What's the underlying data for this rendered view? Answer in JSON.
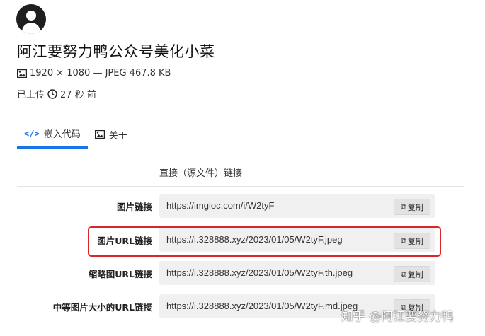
{
  "header": {
    "title": "阿江要努力鸭公众号美化小菜",
    "meta": "1920 × 1080 — JPEG 467.8 KB",
    "uploaded_prefix": "已上传",
    "uploaded_time": "27 秒 前"
  },
  "tabs": [
    {
      "label": "嵌入代码",
      "icon": "code-icon",
      "active": true
    },
    {
      "label": "关于",
      "icon": "image-icon",
      "active": false
    }
  ],
  "embed": {
    "section_label": "直接（源文件）链接",
    "rows": [
      {
        "label": "图片链接",
        "url": "https://imgloc.com/i/W2tyF",
        "copy": "复制"
      },
      {
        "label": "图片URL链接",
        "url": "https://i.328888.xyz/2023/01/05/W2tyF.jpeg",
        "copy": "复制"
      },
      {
        "label": "缩略图URL链接",
        "url": "https://i.328888.xyz/2023/01/05/W2tyF.th.jpeg",
        "copy": "复制"
      },
      {
        "label": "中等图片大小的URL链接",
        "url": "https://i.328888.xyz/2023/01/05/W2tyF.md.jpeg",
        "copy": "复制"
      }
    ]
  },
  "watermark": "知乎 @阿江要努力鸭",
  "colors": {
    "accent": "#1a73e8",
    "highlight": "#d9262b",
    "field_bg": "#f0f0f0"
  }
}
